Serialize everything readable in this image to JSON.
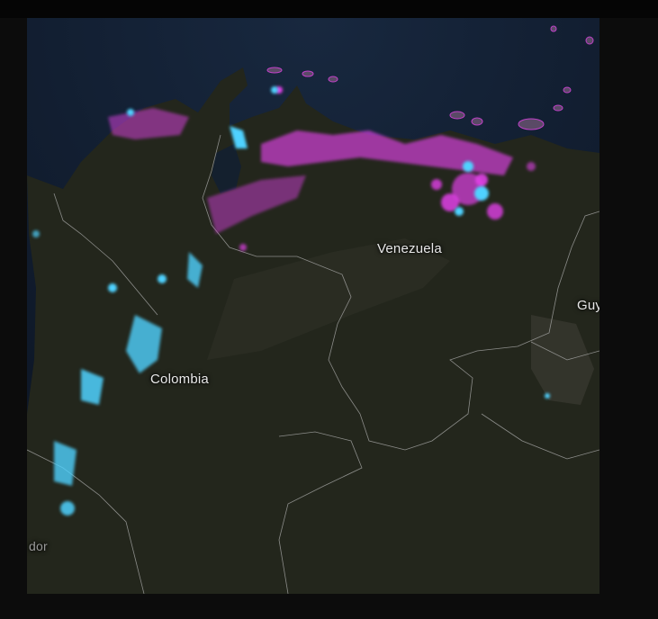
{
  "map": {
    "labels": {
      "venezuela": "Venezuela",
      "colombia": "Colombia",
      "guyana_partial": "Guy",
      "ecuador_partial": "dor"
    },
    "colors": {
      "ocean": "#15233a",
      "land": "#23261c",
      "highlight_magenta": "#e040e6",
      "highlight_cyan": "#4fd2ff",
      "border": "#b8b8b8"
    }
  }
}
